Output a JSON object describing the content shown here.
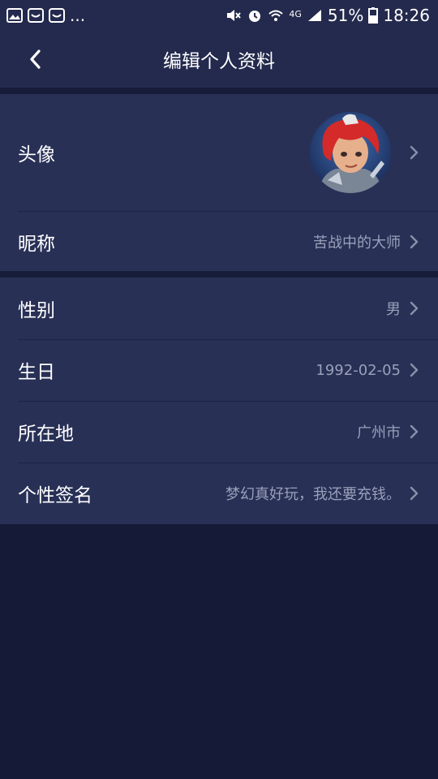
{
  "status_bar": {
    "ellipsis": "...",
    "network": "4G",
    "battery": "51%",
    "time": "18:26"
  },
  "header": {
    "title": "编辑个人资料"
  },
  "profile": {
    "avatar_label": "头像",
    "nickname_label": "昵称",
    "nickname_value": "苦战中的大师"
  },
  "details": {
    "gender_label": "性别",
    "gender_value": "男",
    "birthday_label": "生日",
    "birthday_value": "1992-02-05",
    "location_label": "所在地",
    "location_value": "广州市",
    "signature_label": "个性签名",
    "signature_value": "梦幻真好玩，我还要充钱。"
  },
  "colors": {
    "background": "#151a36",
    "header": "#242a4d",
    "section": "#283056",
    "muted_text": "#9aa0b9"
  }
}
